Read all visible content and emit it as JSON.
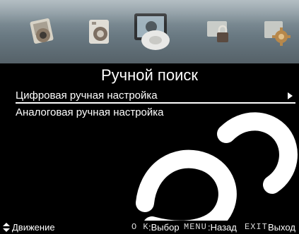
{
  "top_menu": {
    "icons": [
      {
        "name": "picture-icon"
      },
      {
        "name": "sound-icon"
      },
      {
        "name": "channel-search-icon",
        "active": true
      },
      {
        "name": "lock-icon"
      },
      {
        "name": "settings-icon"
      }
    ]
  },
  "title": "Ручной поиск",
  "items": [
    {
      "label": "Цифровая ручная настройка",
      "selected": true
    },
    {
      "label": "Аналоговая ручная настройка",
      "selected": false
    }
  ],
  "footer": {
    "move_label": "Движение",
    "ok_key": "O K",
    "ok_label": "Выбор",
    "menu_key": "MENU",
    "menu_label": "Назад",
    "exit_key": "EXIT",
    "exit_label": "Выход"
  },
  "colors": {
    "background": "#000000",
    "text": "#ffffff",
    "topbar": "#7d8b93"
  }
}
